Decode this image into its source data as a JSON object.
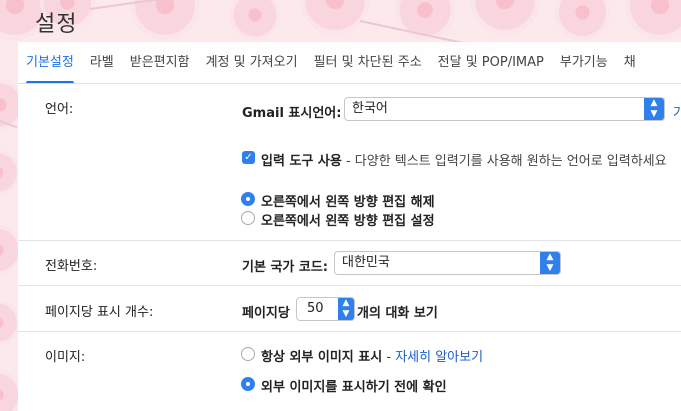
{
  "page_title": "설정",
  "tabs": [
    {
      "label": "기본설정"
    },
    {
      "label": "라벨"
    },
    {
      "label": "받은편지함"
    },
    {
      "label": "계정 및 가져오기"
    },
    {
      "label": "필터 및 차단된 주소"
    },
    {
      "label": "전달 및 POP/IMAP"
    },
    {
      "label": "부가기능"
    },
    {
      "label": "채"
    }
  ],
  "language": {
    "label": "언어:",
    "display_label": "Gmail 표시언어:",
    "display_value": "한국어",
    "cut_text": "가",
    "input_tools_label": "입력 도구 사용",
    "input_tools_desc": " - 다양한 텍스트 입력기를 사용해 원하는 언어로 입력하세요",
    "rtl_off": "오른쪽에서 왼쪽 방향 편집 해제",
    "rtl_on": "오른쪽에서 왼쪽 방향 편집 설정"
  },
  "phone": {
    "label": "전화번호:",
    "country_label": "기본 국가 코드:",
    "country_value": "대한민국"
  },
  "page_size": {
    "label": "페이지당 표시 개수:",
    "prefix": "페이지당",
    "value": "50",
    "suffix": "개의 대화 보기"
  },
  "images": {
    "label": "이미지:",
    "always_show": "항상 외부 이미지 표시",
    "learn_more_sep": " - ",
    "learn_more": "자세히 알아보기",
    "ask_first": "외부 이미지를 표시하기 전에 확인"
  },
  "colors": {
    "accent": "#1a73e8",
    "control_blue": "#2f80ed"
  }
}
